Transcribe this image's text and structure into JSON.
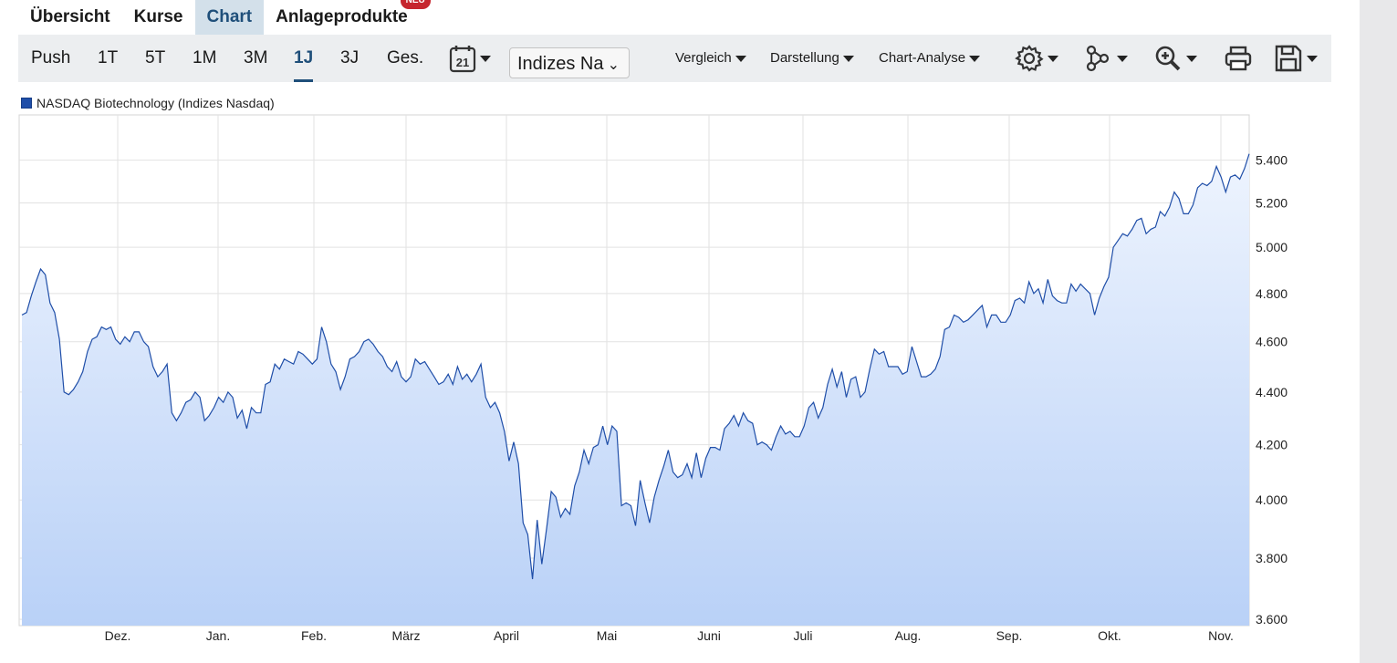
{
  "tabs": [
    {
      "label": "Übersicht",
      "active": false
    },
    {
      "label": "Kurse",
      "active": false
    },
    {
      "label": "Chart",
      "active": true
    },
    {
      "label": "Anlageprodukte",
      "active": false,
      "badge": "NEU"
    }
  ],
  "toolbar": {
    "periods": [
      "Push",
      "1T",
      "5T",
      "1M",
      "3M",
      "1J",
      "3J",
      "Ges."
    ],
    "active_period": "1J",
    "calendar_icon_text": "21",
    "exchange_select": "Indizes Na",
    "dropdowns": [
      "Vergleich",
      "Darstellung",
      "Chart-Analyse"
    ],
    "icons": [
      "settings-gear-icon",
      "indicators-icon",
      "zoom-icon",
      "print-icon",
      "save-icon"
    ]
  },
  "legend": {
    "label": "NASDAQ Biotechnology  (Indizes Nasdaq)",
    "color": "#1f4ea8"
  },
  "chart_data": {
    "type": "area",
    "series": [
      {
        "name": "NASDAQ Biotechnology  (Indizes Nasdaq)",
        "values": [
          4710,
          4720,
          4790,
          4850,
          4905,
          4880,
          4760,
          4720,
          4610,
          4400,
          4390,
          4410,
          4440,
          4480,
          4560,
          4610,
          4620,
          4660,
          4650,
          4660,
          4610,
          4590,
          4620,
          4600,
          4640,
          4640,
          4600,
          4580,
          4500,
          4460,
          4480,
          4510,
          4320,
          4290,
          4320,
          4360,
          4370,
          4400,
          4380,
          4290,
          4310,
          4340,
          4380,
          4360,
          4400,
          4380,
          4300,
          4330,
          4260,
          4340,
          4320,
          4320,
          4430,
          4440,
          4510,
          4490,
          4530,
          4520,
          4510,
          4560,
          4550,
          4530,
          4510,
          4530,
          4660,
          4600,
          4510,
          4480,
          4410,
          4460,
          4530,
          4540,
          4560,
          4600,
          4610,
          4590,
          4560,
          4540,
          4500,
          4480,
          4520,
          4460,
          4440,
          4460,
          4530,
          4510,
          4520,
          4490,
          4460,
          4430,
          4440,
          4470,
          4430,
          4500,
          4450,
          4470,
          4440,
          4470,
          4510,
          4380,
          4340,
          4360,
          4320,
          4250,
          4140,
          4210,
          4130,
          3920,
          3880,
          3730,
          3930,
          3780,
          3900,
          4030,
          4010,
          3940,
          3970,
          3950,
          4050,
          4100,
          4180,
          4130,
          4190,
          4200,
          4270,
          4200,
          4270,
          4250,
          3980,
          3990,
          3980,
          3910,
          4070,
          3990,
          3920,
          4010,
          4070,
          4120,
          4180,
          4100,
          4080,
          4090,
          4130,
          4080,
          4170,
          4080,
          4150,
          4190,
          4190,
          4180,
          4260,
          4280,
          4310,
          4270,
          4320,
          4290,
          4280,
          4200,
          4210,
          4200,
          4180,
          4230,
          4270,
          4240,
          4250,
          4230,
          4230,
          4270,
          4340,
          4360,
          4300,
          4340,
          4430,
          4490,
          4420,
          4480,
          4380,
          4450,
          4460,
          4380,
          4400,
          4490,
          4570,
          4550,
          4560,
          4500,
          4500,
          4500,
          4470,
          4480,
          4580,
          4520,
          4460,
          4460,
          4470,
          4490,
          4540,
          4650,
          4660,
          4710,
          4700,
          4680,
          4690,
          4710,
          4730,
          4750,
          4660,
          4710,
          4710,
          4680,
          4680,
          4710,
          4770,
          4780,
          4760,
          4850,
          4800,
          4820,
          4760,
          4860,
          4790,
          4770,
          4760,
          4760,
          4840,
          4810,
          4840,
          4820,
          4800,
          4710,
          4780,
          4830,
          4870,
          5000,
          5030,
          5060,
          5050,
          5080,
          5120,
          5130,
          5060,
          5080,
          5090,
          5160,
          5140,
          5180,
          5250,
          5220,
          5150,
          5150,
          5190,
          5270,
          5290,
          5280,
          5300,
          5370,
          5320,
          5250,
          5320,
          5330,
          5310,
          5360,
          5430
        ]
      }
    ],
    "x_tick_labels": [
      "Dez.",
      "Jan.",
      "Feb.",
      "März",
      "April",
      "Mai",
      "Juni",
      "Juli",
      "Aug.",
      "Sep.",
      "Okt.",
      "Nov."
    ],
    "y_ticks": [
      3600,
      3800,
      4000,
      4200,
      4400,
      4600,
      4800,
      5000,
      5200,
      5400
    ],
    "y_tick_labels": [
      "3.600",
      "3.800",
      "4.000",
      "4.200",
      "4.400",
      "4.600",
      "4.800",
      "5.000",
      "5.200",
      "5.400"
    ],
    "ylim": [
      3580,
      5620
    ],
    "y_scale": "log",
    "grid": true,
    "legend_position": "top-left",
    "line_color": "#1f4ea8",
    "fill_color_top": "#eef4fe",
    "fill_color_bottom": "#b9d1f7"
  }
}
